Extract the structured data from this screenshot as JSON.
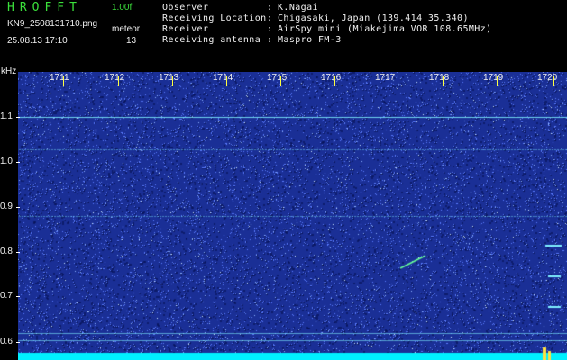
{
  "header": {
    "app_title": "HROFFT",
    "version": "1.00f",
    "filename": "KN9_2508131710.png",
    "mode": "meteor",
    "datetime": "25.08.13 17:10",
    "count": "13"
  },
  "info": [
    {
      "label": "Observer",
      "value": "K.Nagai"
    },
    {
      "label": "Receiving Location",
      "value": "Chigasaki, Japan (139.414 35.340)"
    },
    {
      "label": "Receiver",
      "value": "AirSpy mini (Miakejima VOR 108.65MHz)"
    },
    {
      "label": "Receiving antenna",
      "value": "Maspro FM-3"
    }
  ],
  "colon": ":",
  "spectrogram": {
    "y_unit": "kHz",
    "y_labels": [
      "1.1",
      "1.0",
      "0.9",
      "0.8",
      "0.7",
      "0.6"
    ],
    "time_labels": [
      "1711",
      "1712",
      "1713",
      "1714",
      "1715",
      "1716",
      "1717",
      "1718",
      "1719",
      "1720"
    ],
    "colors": {
      "background": "#1a2f96",
      "noise": "#5a7cff",
      "signal": "#7ff0ff",
      "baseline": "#00f0ff"
    }
  }
}
